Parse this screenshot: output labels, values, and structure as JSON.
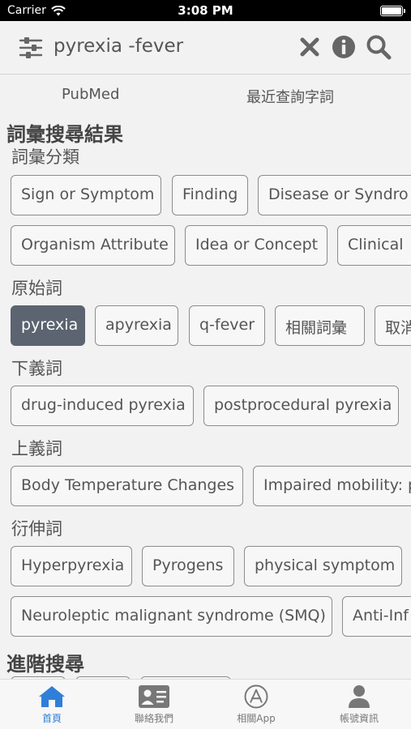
{
  "status_bar": {
    "carrier": "Carrier",
    "time": "3:08 PM"
  },
  "search": {
    "query": "pyrexia -fever"
  },
  "tabs": [
    {
      "label": "PubMed"
    },
    {
      "label": "最近查詢字詞"
    }
  ],
  "results": {
    "title": "詞彙搜尋結果",
    "groups": [
      {
        "title": "詞彙分類",
        "rows": [
          [
            "Sign or Symptom",
            "Finding",
            "Disease or Syndro"
          ],
          [
            "Organism Attribute",
            "Idea or Concept",
            "Clinical"
          ]
        ]
      },
      {
        "title": "原始詞",
        "rows": [
          [
            "pyrexia",
            "apyrexia",
            "q-fever",
            "相關詞彙",
            "取消"
          ]
        ]
      },
      {
        "title": "下義詞",
        "rows": [
          [
            "drug-induced pyrexia",
            "postprocedural pyrexia"
          ]
        ]
      },
      {
        "title": "上義詞",
        "rows": [
          [
            "Body Temperature Changes",
            "Impaired mobility: p"
          ]
        ]
      },
      {
        "title": "衍伸詞",
        "rows": [
          [
            "Hyperpyrexia",
            "Pyrogens",
            "physical symptom"
          ],
          [
            "Neuroleptic malignant syndrome (SMQ)",
            "Anti-Inf"
          ]
        ]
      }
    ]
  },
  "advanced": {
    "title": "進階搜尋"
  },
  "tab_bar": [
    {
      "label": "首頁",
      "icon": "home-icon",
      "active": true
    },
    {
      "label": "聯絡我們",
      "icon": "contact-card-icon",
      "active": false
    },
    {
      "label": "相關App",
      "icon": "app-store-icon",
      "active": false
    },
    {
      "label": "帳號資訊",
      "icon": "account-icon",
      "active": false
    }
  ],
  "colors": {
    "accent": "#2f7fd8",
    "chip_active": "#5b6470",
    "chip_border": "#8c8c8c"
  }
}
